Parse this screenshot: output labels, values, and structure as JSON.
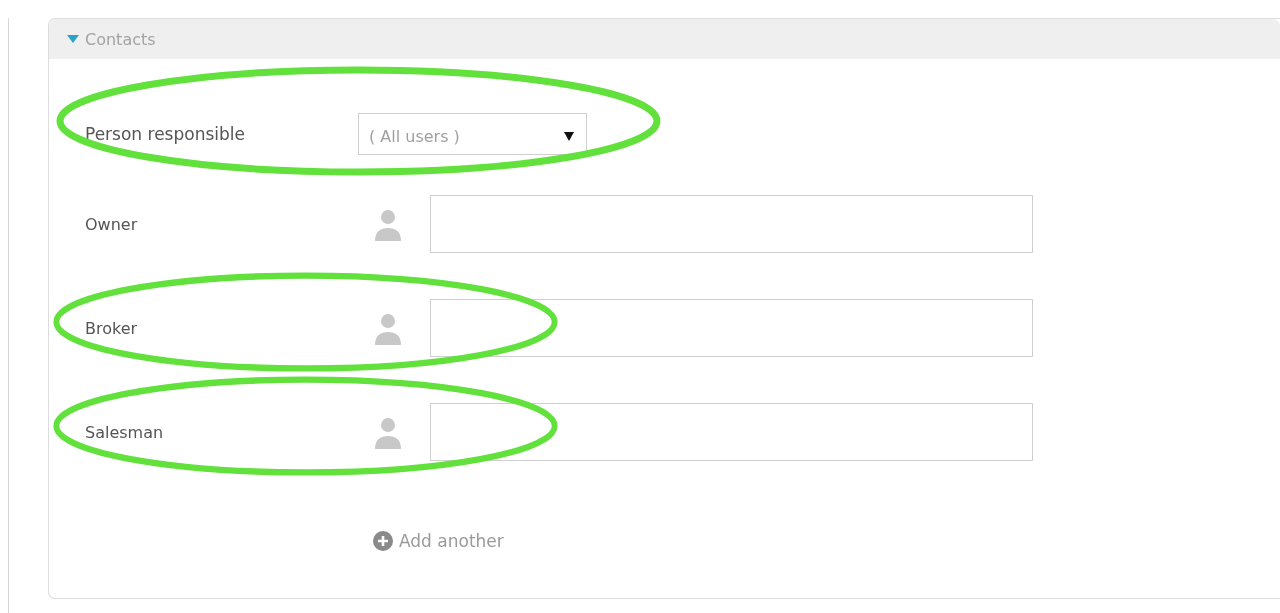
{
  "section": {
    "title": "Contacts",
    "expanded": true
  },
  "fields": [
    {
      "kind": "select",
      "label": "Person responsible",
      "value": "( All users )",
      "circled": true
    },
    {
      "kind": "person",
      "label": "Owner",
      "circled": false
    },
    {
      "kind": "person",
      "label": "Broker",
      "circled": true
    },
    {
      "kind": "person",
      "label": "Salesman",
      "circled": true
    }
  ],
  "add_link": "Add another"
}
